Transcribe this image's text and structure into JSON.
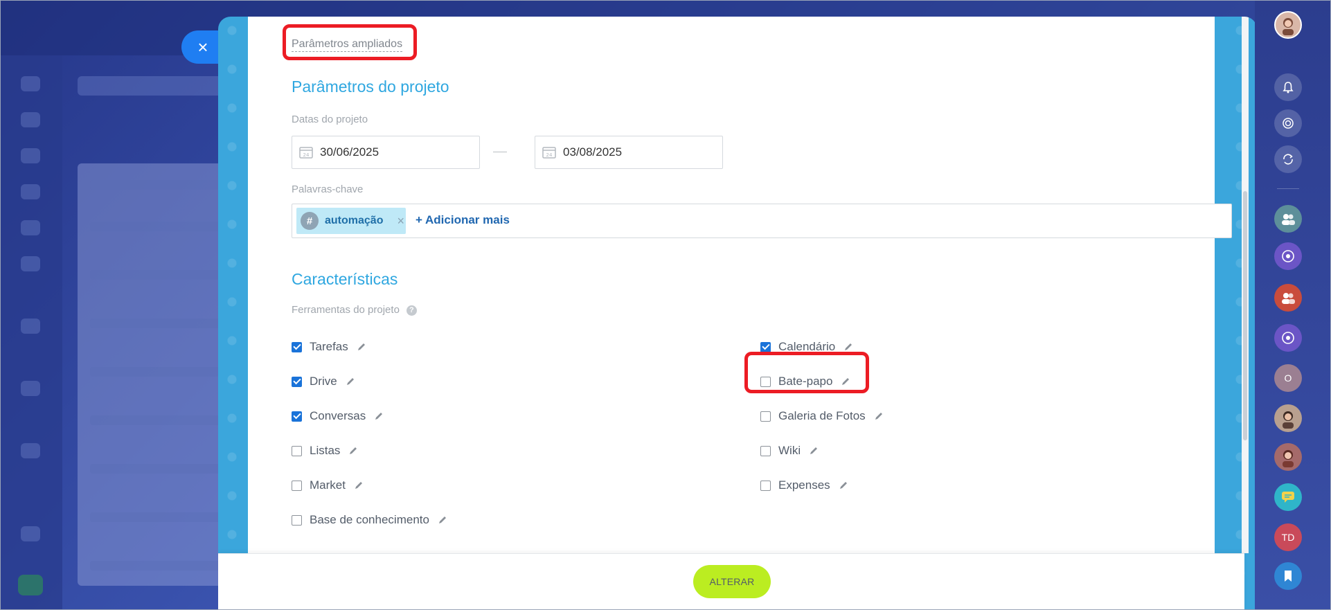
{
  "panel": {
    "advanced_link": "Parâmetros ampliados",
    "project_params_title": "Parâmetros do projeto",
    "dates_label": "Datas do projeto",
    "date_start": "30/06/2025",
    "date_end": "03/08/2025",
    "date_icon_day": "24",
    "keywords_label": "Palavras-chave",
    "tag_hash": "#",
    "keyword_tag": "automação",
    "tag_remove": "×",
    "add_more": "+ Adicionar mais",
    "features_title": "Características",
    "tools_label": "Ferramentas do projeto",
    "help": "?",
    "tools_left": [
      {
        "label": "Tarefas",
        "checked": true
      },
      {
        "label": "Drive",
        "checked": true
      },
      {
        "label": "Conversas",
        "checked": true
      },
      {
        "label": "Listas",
        "checked": false
      },
      {
        "label": "Market",
        "checked": false
      },
      {
        "label": "Base de conhecimento",
        "checked": false
      }
    ],
    "tools_right": [
      {
        "label": "Calendário",
        "checked": true
      },
      {
        "label": "Bate-papo",
        "checked": false
      },
      {
        "label": "Galeria de Fotos",
        "checked": false
      },
      {
        "label": "Wiki",
        "checked": false
      },
      {
        "label": "Expenses",
        "checked": false
      }
    ],
    "save_button": "ALTERAR",
    "close_glyph": "×"
  },
  "right_bar": {
    "avatar_initial": "O",
    "avatar_td": "TD",
    "colors": {
      "group1": "#5d8f9a",
      "chat1": "#6b55c6",
      "group2": "#c94c3c",
      "chat2": "#6b55c6",
      "o_avatar": "#9b7f92",
      "feed": "#2fb5c9",
      "td": "#c94a5a",
      "bookmark": "#2f86d4"
    }
  },
  "colors": {
    "accent_blue": "#2fa7e0",
    "save_green": "#bbed21",
    "checkbox_blue": "#1a73d9",
    "highlight_red": "#ec1c24"
  }
}
